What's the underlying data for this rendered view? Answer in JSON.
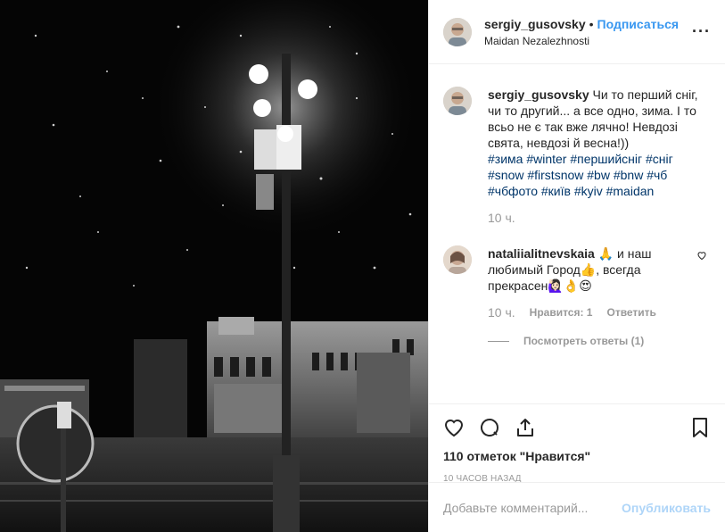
{
  "post": {
    "author": "sergiy_gusovsky",
    "separator": "•",
    "follow_label": "Подписаться",
    "location": "Maidan Nezalezhnosti",
    "more_label": "···"
  },
  "caption": {
    "author": "sergiy_gusovsky",
    "text": "Чи то перший сніг, чи то другий... а все одно, зима. І то всьо не є так вже лячно! Невдозі свята, невдозі й весна!))",
    "hashtags": "#зима #winter #першийсніг #сніг #snow #firstsnow #bw #bnw #чб #чбфото #київ #kyiv #maidan",
    "time": "10 ч."
  },
  "comment": {
    "author": "nataliialitnevskaia",
    "text": "🙏 и наш любимый Город👍, всегда прекрасен🙋🏻‍♀️👌😍",
    "time": "10 ч.",
    "likes_label": "Нравится: 1",
    "reply_label": "Ответить",
    "view_replies": "Посмотреть ответы (1)"
  },
  "actions": {
    "likes": "110 отметок \"Нравится\"",
    "timestamp": "10 ЧАСОВ НАЗАД"
  },
  "add_comment": {
    "placeholder": "Добавьте комментарий...",
    "publish_label": "Опубликовать"
  },
  "colors": {
    "accent": "#3897f0",
    "hashtag": "#003569",
    "muted": "#999999"
  }
}
